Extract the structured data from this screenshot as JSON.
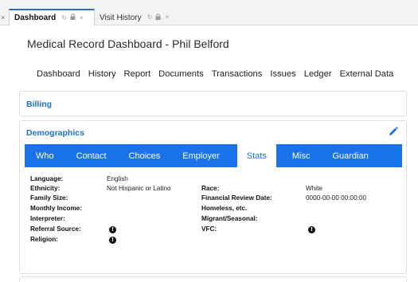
{
  "tabs": [
    {
      "label": "Dashboard",
      "active": true
    },
    {
      "label": "Visit History",
      "active": false
    }
  ],
  "tab_icons": {
    "refresh": "↻",
    "lock": "🔒",
    "close": "×"
  },
  "page": {
    "title": "Medical Record Dashboard - Phil Belford"
  },
  "menu": [
    "Dashboard",
    "History",
    "Report",
    "Documents",
    "Transactions",
    "Issues",
    "Ledger",
    "External Data"
  ],
  "billing": {
    "title": "Billing"
  },
  "demographics": {
    "title": "Demographics",
    "subtabs": [
      "Who",
      "Contact",
      "Choices",
      "Employer",
      "Stats",
      "Misc",
      "Guardian"
    ],
    "active_subtab": "Stats",
    "left": [
      {
        "label": "Language:",
        "value": "English"
      },
      {
        "label": "Ethnicity:",
        "value": "Not Hispanic or Latino"
      },
      {
        "label": "Family Size:",
        "value": ""
      },
      {
        "label": "Monthly Income:",
        "value": ""
      },
      {
        "label": "Interpreter:",
        "value": ""
      },
      {
        "label": "Referral Source:",
        "value": ""
      },
      {
        "label": "Religion:",
        "value": ""
      }
    ],
    "right": [
      {
        "label": "Race:",
        "value": "White"
      },
      {
        "label": "Financial Review Date:",
        "value": "0000-00-00 00:00:00"
      },
      {
        "label": "Homeless, etc.",
        "value": ""
      },
      {
        "label": "Migrant/Seasonal:",
        "value": ""
      },
      {
        "label": "VFC:",
        "value": ""
      }
    ]
  },
  "colors": {
    "accent": "#1a73e8",
    "heading": "#1a73c8",
    "tab_active_border": "#2e6ec8"
  }
}
